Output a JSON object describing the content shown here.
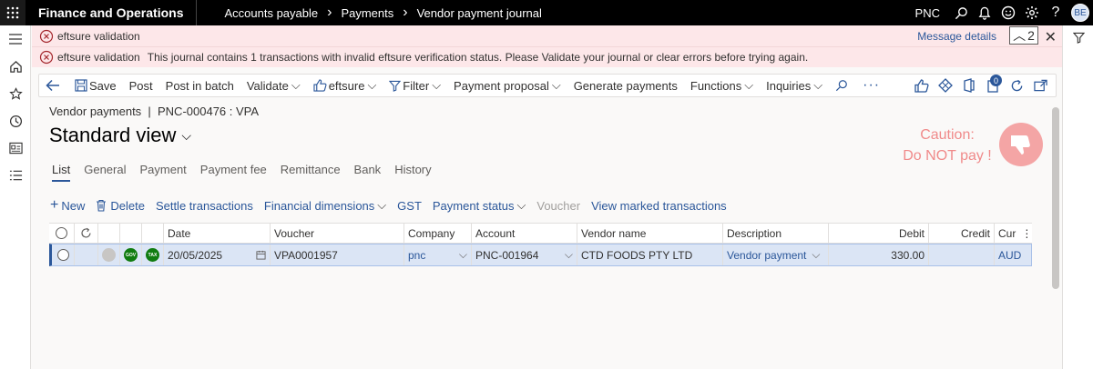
{
  "topbar": {
    "app_title": "Finance and Operations",
    "breadcrumbs": [
      "Accounts payable",
      "Payments",
      "Vendor payment journal"
    ],
    "company": "PNC",
    "avatar_initials": "BE"
  },
  "messages": [
    {
      "title": "eftsure validation",
      "details_link": "Message details",
      "count": "2"
    },
    {
      "title": "eftsure validation",
      "text": "This journal contains 1 transactions with invalid eftsure verification status. Please Validate your journal or clear errors before trying again."
    }
  ],
  "action_pane": {
    "items": [
      "Save",
      "Post",
      "Post in batch",
      "Validate",
      "eftsure",
      "Filter",
      "Payment proposal",
      "Generate payments",
      "Functions",
      "Inquiries"
    ],
    "notification_count": "0"
  },
  "caption": "Vendor payments  |  PNC-000476 : VPA",
  "view_title": "Standard view",
  "caution": {
    "line1": "Caution:",
    "line2": "Do NOT pay !"
  },
  "tabs": [
    "List",
    "General",
    "Payment",
    "Payment fee",
    "Remittance",
    "Bank",
    "History"
  ],
  "grid_toolbar": {
    "new": "New",
    "delete": "Delete",
    "settle": "Settle transactions",
    "financial_dimensions": "Financial dimensions",
    "gst": "GST",
    "payment_status": "Payment status",
    "voucher": "Voucher",
    "view_marked": "View marked transactions"
  },
  "grid": {
    "columns": [
      "Date",
      "Voucher",
      "Company",
      "Account",
      "Vendor name",
      "Description",
      "Debit",
      "Credit",
      "Cur"
    ],
    "rows": [
      {
        "badge1": "GOV",
        "badge2": "TAX",
        "date": "20/05/2025",
        "voucher": "VPA0001957",
        "company": "pnc",
        "account": "PNC-001964",
        "vendor_name": "CTD FOODS PTY LTD",
        "description": "Vendor payment",
        "debit": "330.00",
        "credit": "",
        "currency": "AUD"
      }
    ]
  },
  "colors": {
    "accent": "#2b579a",
    "error_bg": "#fde7e9",
    "caution": "#f08a8a"
  }
}
